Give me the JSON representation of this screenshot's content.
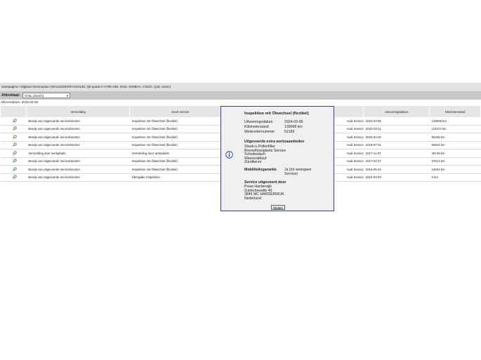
{
  "breadcrumb": "Startpagina / Digitaal Serviceplan (WAUZZZ8X0FA104136, Q5 quat2.0 HY05 A85, 2015, 8X0BAA, CNCD, QJZ, enein)",
  "language": {
    "label": "Afdruktaal:",
    "selected": "nl-NL (Dutch)"
  },
  "delivery_date": "Afleverdatum: 2015-03-06",
  "table": {
    "headers": [
      "",
      "Vermelding",
      "Soort service",
      "",
      "Uitvoeringsdatum",
      "Kilometerstand"
    ],
    "rows": [
      {
        "vermelding": "Bewijs van uitgevoerde servicebeurten",
        "soort": "Inspektion mit Ölwechsel (flexibel)",
        "by": "Audi Service",
        "date": "2024-03-06",
        "km": "139068 km"
      },
      {
        "vermelding": "Bewijs van uitgevoerde servicebeurten",
        "soort": "Inspektion mit Ölwechsel (flexibel)",
        "by": "Audi Service",
        "date": "2022-03-21",
        "km": "114374 km"
      },
      {
        "vermelding": "Bewijs van uitgevoerde servicebeurten",
        "soort": "Inspektion mit Ölwechsel (flexibel)",
        "by": "Audi Service",
        "date": "2020-03-20",
        "km": "90258 km"
      },
      {
        "vermelding": "Bewijs van uitgevoerde servicebeurten",
        "soort": "Inspektion mit Ölwechsel (flexibel)",
        "by": "Audi Service",
        "date": "2018-07-31",
        "km": "60524 km"
      },
      {
        "vermelding": "Vermelding door werkplaats",
        "soort": "Vermelding door werkplaats",
        "by": "Audi Service",
        "date": "2017-11-07",
        "km": "48749 km"
      },
      {
        "vermelding": "Bewijs van uitgevoerde servicebeurten",
        "soort": "Inspektion mit Ölwechsel (flexibel)",
        "by": "Audi Service",
        "date": "2017-02-27",
        "km": "37514 km"
      },
      {
        "vermelding": "Bewijs van uitgevoerde servicebeurten",
        "soort": "Inspektion mit Ölwechsel (flexibel)",
        "by": "Audi Service",
        "date": "2016-05-02",
        "km": "24064 km"
      },
      {
        "vermelding": "Bewijs van uitgevoerde servicebeurten",
        "soort": "Übergabe-Inspektion",
        "by": "Audi Service",
        "date": "2015-03-03",
        "km": "0 km"
      }
    ]
  },
  "popup": {
    "title": "Inspektion mit Ölwechsel (flexibel)",
    "fields": [
      {
        "label": "Uitvoeringsdatum",
        "value": "2024-03-06"
      },
      {
        "label": "Kilometerstand",
        "value": "139068 km"
      },
      {
        "label": "Werkordernummer",
        "value": "52183"
      }
    ],
    "extra_heading": "Uitgevoerde extra werkzaamheden",
    "extra_items": [
      "Staub-u.Pollenfilter",
      "Bremsflüssigkeits Service",
      "Scheibedach",
      "Wasserablauf",
      "Zündkerze"
    ],
    "mobility_label": "Mobiliteitsgarantie",
    "mobility_value_1": "Ja (tot weergave",
    "mobility_value_2": "Service)",
    "service_heading": "Service uitgevoerd door",
    "service_lines": [
      "Pouw Harderwijk",
      "Zuiderbreedte 46",
      "3845 MC HARDERWIJK",
      "Nederland"
    ],
    "close_label": "Sluiten"
  },
  "colors": {
    "popup_border": "#3a3aa8",
    "magnifier": "#2e7d32"
  }
}
